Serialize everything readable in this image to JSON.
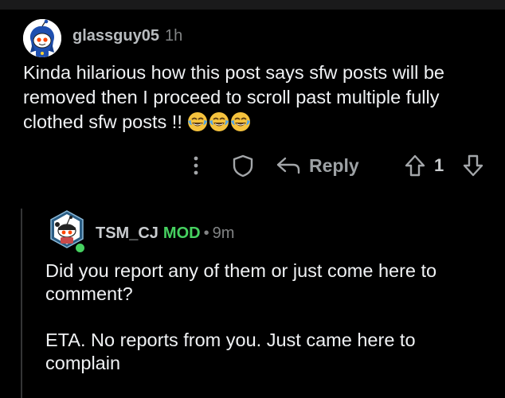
{
  "comment": {
    "username": "glassguy05",
    "time": "1h",
    "text": "Kinda hilarious how this post says sfw posts will be removed then I proceed to scroll past multiple fully clothed sfw posts !!",
    "emojis": [
      "face-with-tears-of-joy",
      "face-with-tears-of-joy",
      "face-with-tears-of-joy"
    ],
    "actions": {
      "reply_label": "Reply",
      "vote_count": "1"
    }
  },
  "reply": {
    "username": "TSM_CJ",
    "badge": "MOD",
    "separator": "•",
    "time": "9m",
    "paragraphs": [
      "Did you report any of them or just come here to comment?",
      "ETA. No reports from you. Just came here to complain"
    ]
  },
  "colors": {
    "background": "#000000",
    "text": "#f0f2f4",
    "meta": "#818384",
    "mod_green": "#46d160"
  }
}
